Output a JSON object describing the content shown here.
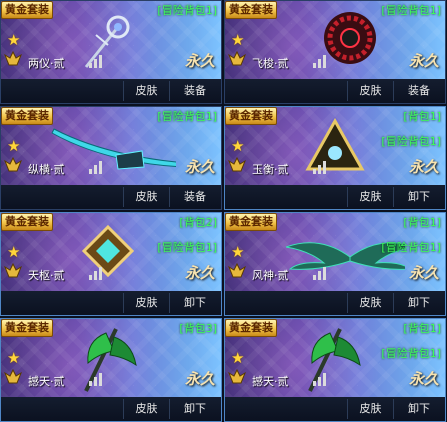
{
  "cards": [
    {
      "tag": "黄金套装",
      "name": "两仪·贰",
      "bags": [
        "[冒险背包1]"
      ],
      "perm": "永久",
      "skin": "皮肤",
      "action": "装备",
      "selected": false,
      "art": "ring-staff-icon"
    },
    {
      "tag": "黄金套装",
      "name": "飞梭·贰",
      "bags": [
        "[冒险背包1]"
      ],
      "perm": "永久",
      "skin": "皮肤",
      "action": "装备",
      "selected": false,
      "art": "disc-blade-icon"
    },
    {
      "tag": "黄金套装",
      "name": "纵横·贰",
      "bags": [
        "[冒险背包1]"
      ],
      "perm": "永久",
      "skin": "皮肤",
      "action": "装备",
      "selected": false,
      "art": "long-sword-icon"
    },
    {
      "tag": "黄金套装",
      "name": "玉衡·贰",
      "bags": [
        "[背包1]",
        "[冒险背包1]"
      ],
      "perm": "永久",
      "skin": "皮肤",
      "action": "卸下",
      "selected": true,
      "art": "pyramid-icon"
    },
    {
      "tag": "黄金套装",
      "name": "天枢·贰",
      "bags": [
        "[背包2]",
        "[冒险背包1]"
      ],
      "perm": "永久",
      "skin": "皮肤",
      "action": "卸下",
      "selected": true,
      "art": "diamond-emblem-icon"
    },
    {
      "tag": "黄金套装",
      "name": "风神·贰",
      "bags": [
        "[背包1]",
        "[冒险背包1]"
      ],
      "perm": "永久",
      "skin": "皮肤",
      "action": "卸下",
      "selected": true,
      "art": "wings-icon"
    },
    {
      "tag": "黄金套装",
      "name": "撼天·贰",
      "bags": [
        "[背包3]"
      ],
      "perm": "永久",
      "skin": "皮肤",
      "action": "卸下",
      "selected": true,
      "art": "battle-axe-icon"
    },
    {
      "tag": "黄金套装",
      "name": "撼天·贰",
      "bags": [
        "[背包1]",
        "[冒险背包1]"
      ],
      "perm": "永久",
      "skin": "皮肤",
      "action": "卸下",
      "selected": true,
      "art": "battle-axe-icon"
    }
  ]
}
